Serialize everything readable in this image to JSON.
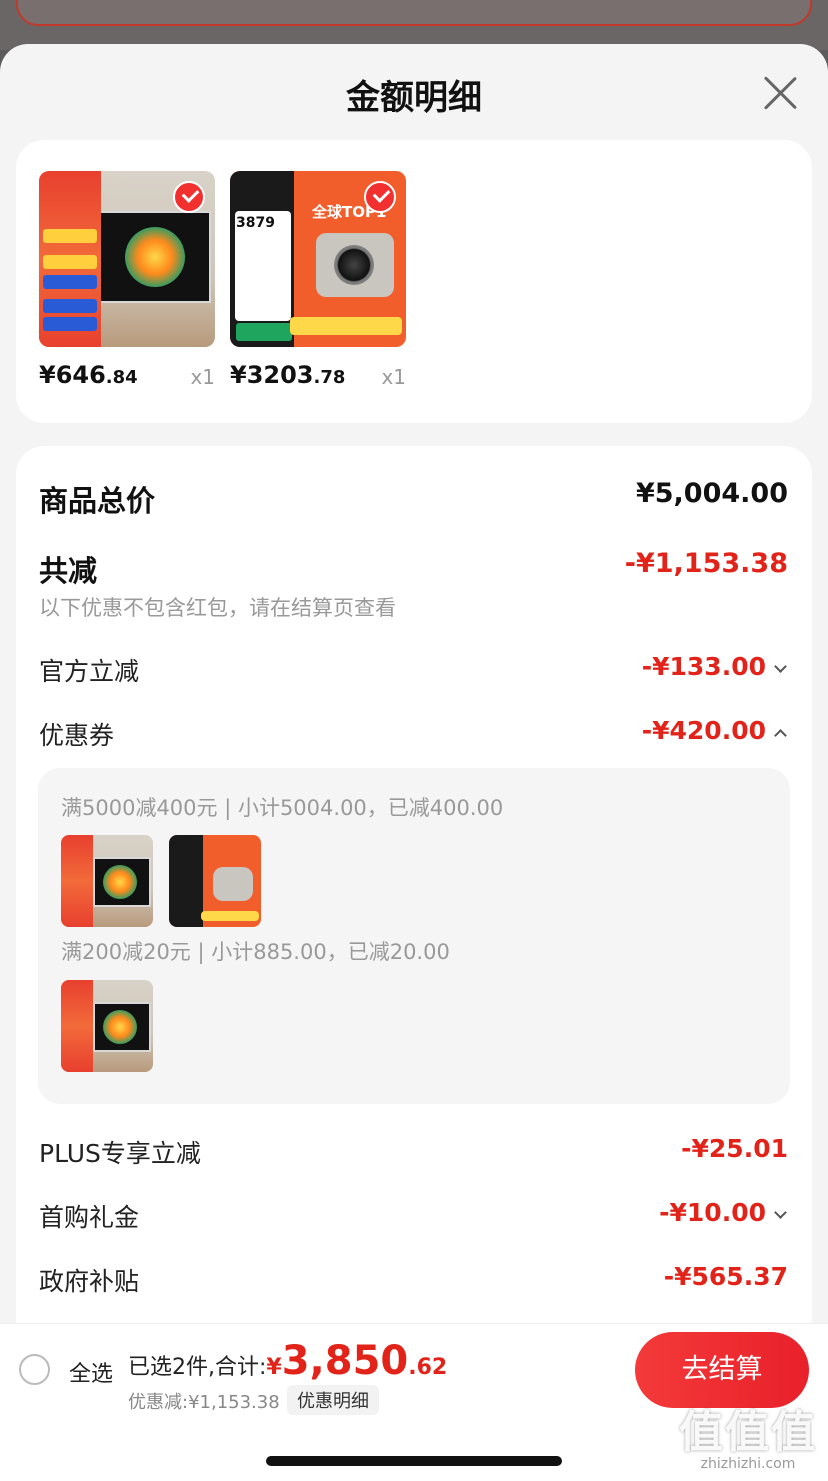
{
  "header": {
    "title": "金额明细"
  },
  "products": [
    {
      "price_main": "¥646",
      "price_dec": ".84",
      "qty": "x1",
      "selected": true
    },
    {
      "price_main": "¥3203",
      "price_dec": ".78",
      "qty": "x1",
      "selected": true,
      "thumb_price": "3879",
      "thumb_headline": "全球TOP1"
    }
  ],
  "details": {
    "total_label": "商品总价",
    "total_value": "¥5,004.00",
    "reduce_label": "共减",
    "reduce_value": "-¥1,153.38",
    "reduce_hint": "以下优惠不包含红包，请在结算页查看",
    "items": [
      {
        "label": "官方立减",
        "value": "-¥133.00",
        "arrow": "down"
      },
      {
        "label": "优惠券",
        "value": "-¥420.00",
        "arrow": "up"
      },
      {
        "label": "PLUS专享立减",
        "value": "-¥25.01",
        "arrow": "none"
      },
      {
        "label": "首购礼金",
        "value": "-¥10.00",
        "arrow": "down"
      },
      {
        "label": "政府补贴",
        "value": "-¥565.37",
        "arrow": "none"
      }
    ],
    "coupons": [
      {
        "text": "满5000减400元 | 小计5004.00，已减400.00"
      },
      {
        "text": "满200减20元 | 小计885.00，已减20.00"
      }
    ]
  },
  "bottom": {
    "select_all": "全选",
    "selected_text": "已选2件,合计:",
    "currency": "¥",
    "total_int": "3,850",
    "total_dec": ".62",
    "discount_text": "优惠减:¥1,153.38",
    "detail_link": "优惠明细",
    "checkout": "去结算"
  },
  "watermark": {
    "big": "值值值",
    "small": "zhizhizhi.com"
  },
  "colors": {
    "accent": "#e2231a",
    "button": "#f43a3a"
  }
}
